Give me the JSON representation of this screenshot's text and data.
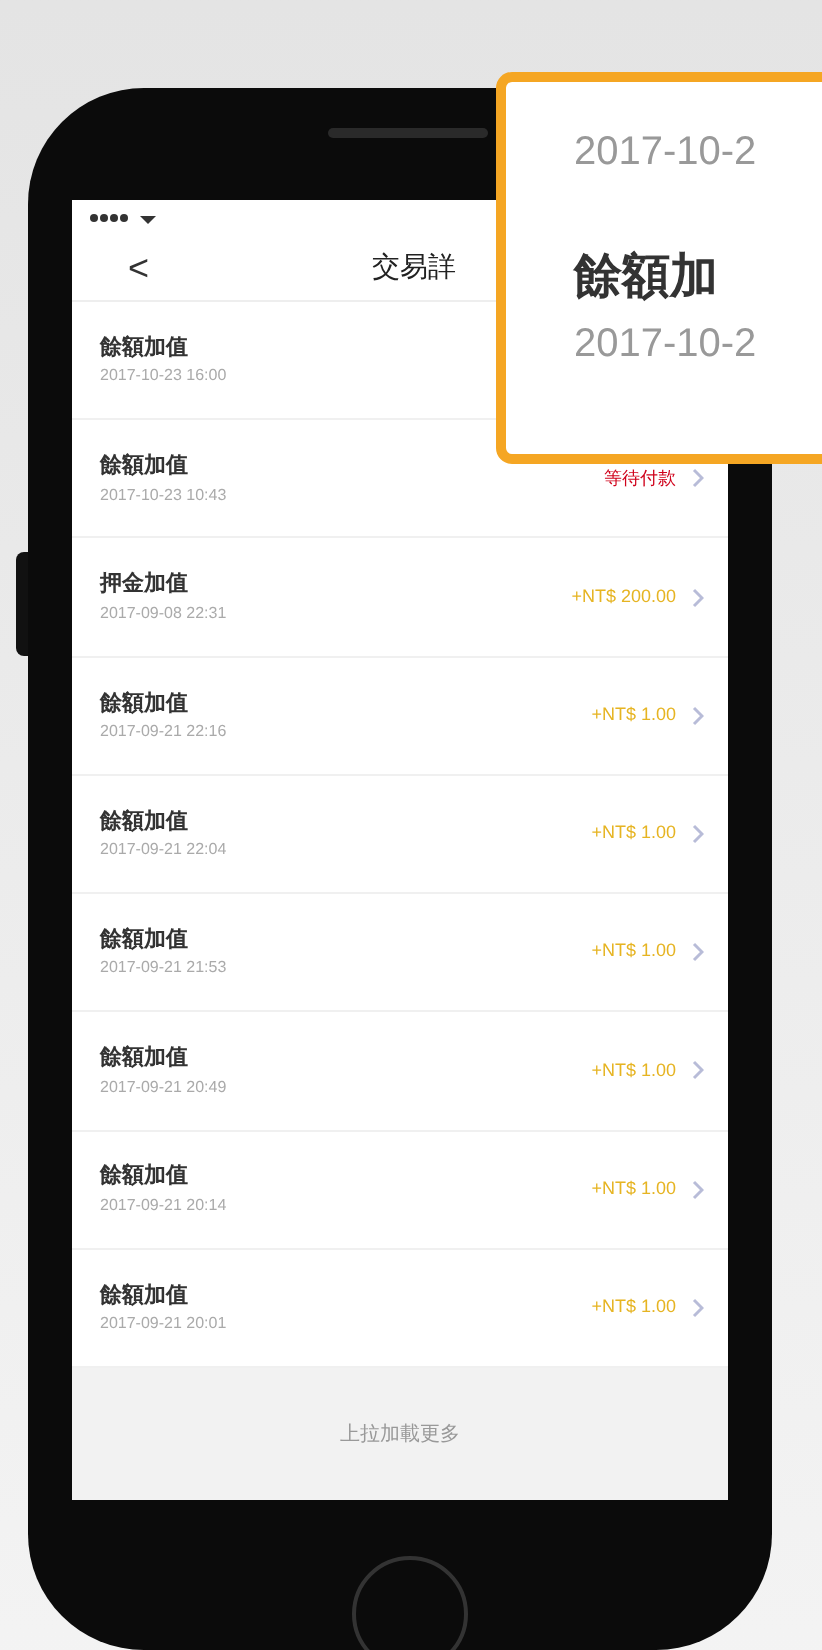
{
  "callout": {
    "top_date": "2017-10-2",
    "title": "餘額加",
    "date": "2017-10-2"
  },
  "nav": {
    "back": "<",
    "title": "交易詳"
  },
  "rows": [
    {
      "name": "餘額加值",
      "date": "2017-10-23 16:00",
      "kind": "none"
    },
    {
      "name": "餘額加值",
      "date": "2017-10-23 10:43",
      "amount": "等待付款",
      "kind": "pending"
    },
    {
      "name": "押金加值",
      "date": "2017-09-08 22:31",
      "amount": "+NT$ 200.00",
      "kind": "credit"
    },
    {
      "name": "餘額加值",
      "date": "2017-09-21 22:16",
      "amount": "+NT$ 1.00",
      "kind": "credit"
    },
    {
      "name": "餘額加值",
      "date": "2017-09-21 22:04",
      "amount": "+NT$ 1.00",
      "kind": "credit"
    },
    {
      "name": "餘額加值",
      "date": "2017-09-21 21:53",
      "amount": "+NT$ 1.00",
      "kind": "credit"
    },
    {
      "name": "餘額加值",
      "date": "2017-09-21 20:49",
      "amount": "+NT$ 1.00",
      "kind": "credit"
    },
    {
      "name": "餘額加值",
      "date": "2017-09-21 20:14",
      "amount": "+NT$ 1.00",
      "kind": "credit"
    },
    {
      "name": "餘額加值",
      "date": "2017-09-21 20:01",
      "amount": "+NT$ 1.00",
      "kind": "credit"
    }
  ],
  "footer": "上拉加載更多"
}
